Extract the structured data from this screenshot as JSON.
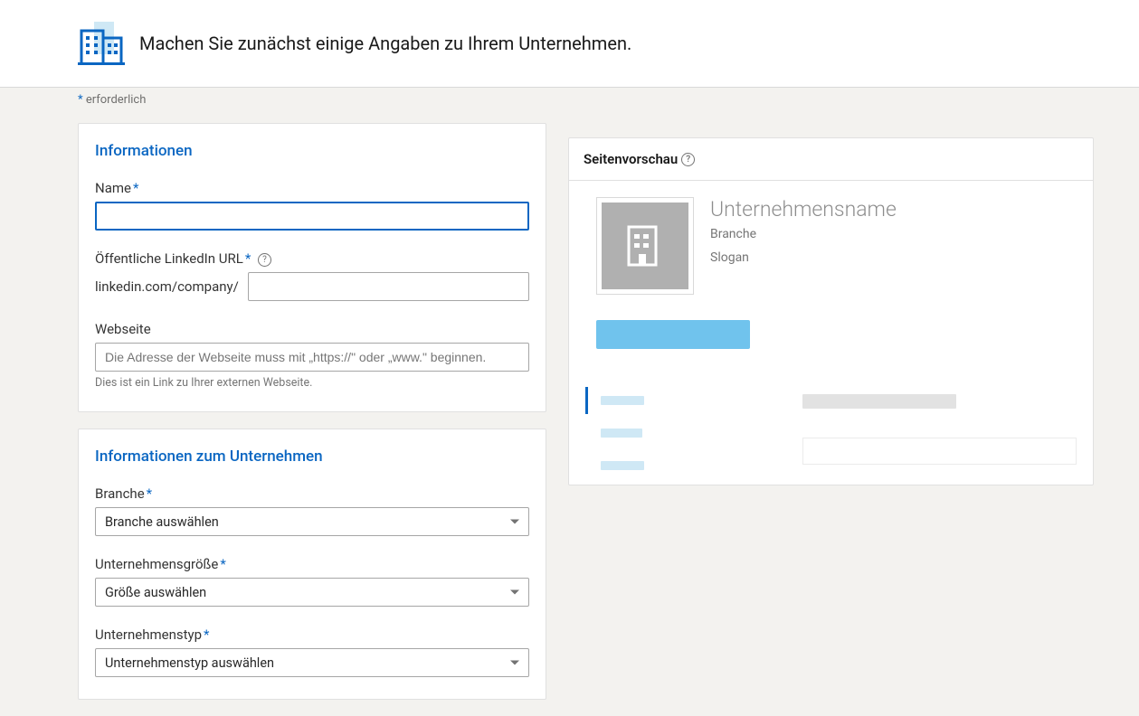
{
  "header": {
    "title": "Machen Sie zunächst einige Angaben zu Ihrem Unternehmen."
  },
  "required_label": "erforderlich",
  "section_info": {
    "title": "Informationen",
    "name": {
      "label": "Name"
    },
    "url": {
      "label": "Öffentliche LinkedIn URL",
      "prefix": "linkedin.com/company/"
    },
    "website": {
      "label": "Webseite",
      "placeholder": "Die Adresse der Webseite muss mit „https://\" oder „www.\" beginnen.",
      "helper": "Dies ist ein Link zu Ihrer externen Webseite."
    }
  },
  "section_company": {
    "title": "Informationen zum Unternehmen",
    "industry": {
      "label": "Branche",
      "placeholder": "Branche auswählen"
    },
    "size": {
      "label": "Unternehmensgröße",
      "placeholder": "Größe auswählen"
    },
    "type": {
      "label": "Unternehmenstyp",
      "placeholder": "Unternehmenstyp auswählen"
    }
  },
  "preview": {
    "header": "Seitenvorschau",
    "company_name": "Unternehmensname",
    "industry": "Branche",
    "slogan": "Slogan"
  }
}
